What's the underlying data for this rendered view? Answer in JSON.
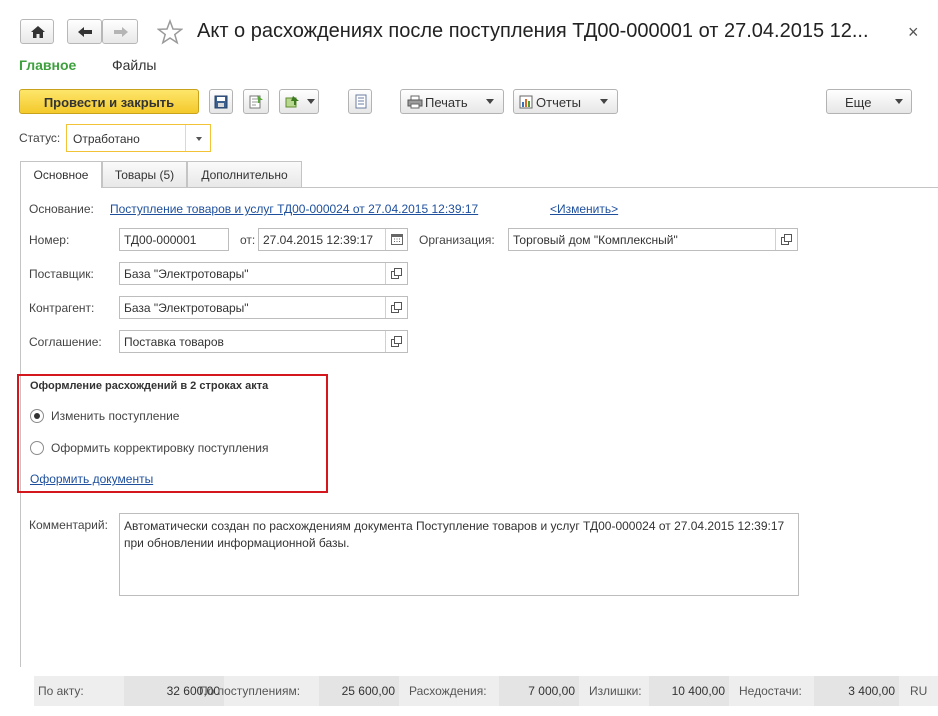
{
  "window": {
    "title": "Акт о расхождениях после поступления ТД00-000001 от 27.04.2015 12...",
    "close": "×"
  },
  "sections": {
    "main": "Главное",
    "files": "Файлы"
  },
  "toolbar": {
    "post_close": "Провести и закрыть",
    "print": "Печать",
    "reports": "Отчеты",
    "more": "Еще"
  },
  "status": {
    "label": "Статус:",
    "value": "Отработано"
  },
  "tabs": [
    {
      "label": "Основное"
    },
    {
      "label": "Товары (5)"
    },
    {
      "label": "Дополнительно"
    }
  ],
  "form": {
    "basis_label": "Основание:",
    "basis_link": "Поступление товаров и услуг ТД00-000024 от 27.04.2015 12:39:17",
    "change_link": "<Изменить>",
    "number_label": "Номер:",
    "number_value": "ТД00-000001",
    "date_label": "от:",
    "date_value": "27.04.2015 12:39:17",
    "org_label": "Организация:",
    "org_value": "Торговый дом \"Комплексный\"",
    "supplier_label": "Поставщик:",
    "supplier_value": "База \"Электротовары\"",
    "counterparty_label": "Контрагент:",
    "counterparty_value": "База \"Электротовары\"",
    "agreement_label": "Соглашение:",
    "agreement_value": "Поставка товаров"
  },
  "discrepancy": {
    "heading": "Оформление расхождений в 2 строках акта",
    "option_change": "Изменить поступление",
    "option_correct": "Оформить корректировку поступления",
    "selected": "option_change",
    "docs_link": "Оформить документы"
  },
  "comment": {
    "label": "Комментарий:",
    "text": "Автоматически создан по расхождениям документа Поступление товаров и услуг ТД00-000024 от 27.04.2015 12:39:17 при обновлении информационной базы."
  },
  "totals": {
    "by_act_label": "По акту:",
    "by_act_value": "32 600,00",
    "by_receipts_label": "По поступлениям:",
    "by_receipts_value": "25 600,00",
    "diff_label": "Расхождения:",
    "diff_value": "7 000,00",
    "surplus_label": "Излишки:",
    "surplus_value": "10 400,00",
    "shortage_label": "Недостачи:",
    "shortage_value": "3 400,00",
    "currency": "RU"
  },
  "colors": {
    "accent_green": "#3da03d",
    "primary_button": "#f4c92b",
    "highlight_red": "#d4161d",
    "link_blue": "#1e4f9c"
  }
}
